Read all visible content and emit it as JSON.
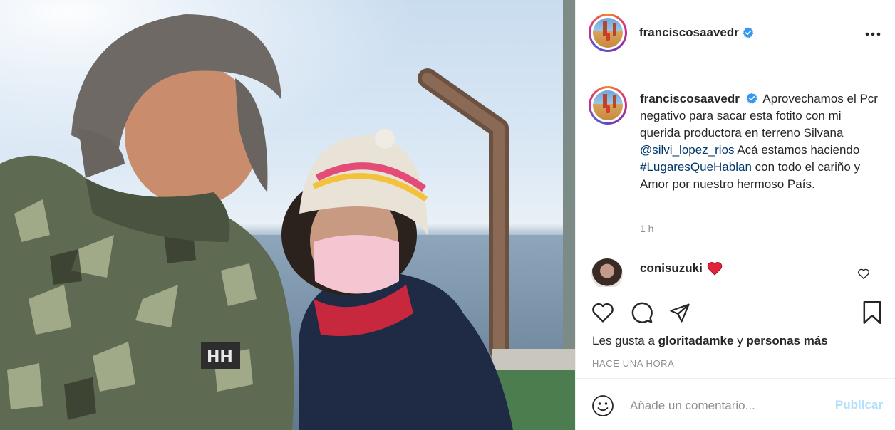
{
  "post": {
    "username": "franciscosaavedr",
    "verified": true,
    "more_icon": "more-horizontal-icon",
    "caption": {
      "username": "franciscosaavedr",
      "text_1": "Aprovechamos el Pcr negativo para sacar esta fotito con mi querida productora en terreno Silvana",
      "mention": "@silvi_lopez_rios",
      "text_2": "Acá estamos haciendo",
      "hashtag": "#LugaresQueHablan",
      "text_3": "con todo el cariño y Amor por nuestro hermoso País.",
      "time": "1 h"
    },
    "comments": [
      {
        "username": "conisuzuki",
        "emoji": "❤️"
      }
    ],
    "likes": {
      "prefix": "Les gusta a",
      "user": "gloritadamke",
      "joiner": "y",
      "others": "personas más"
    },
    "timestamp": "HACE UNA HORA",
    "add_comment": {
      "placeholder": "Añade un comentario...",
      "publish_label": "Publicar"
    },
    "colors": {
      "link": "#00376b",
      "verified": "#3897f0",
      "publish_disabled": "#b2dffc",
      "heart_red": "#ed4956"
    }
  }
}
